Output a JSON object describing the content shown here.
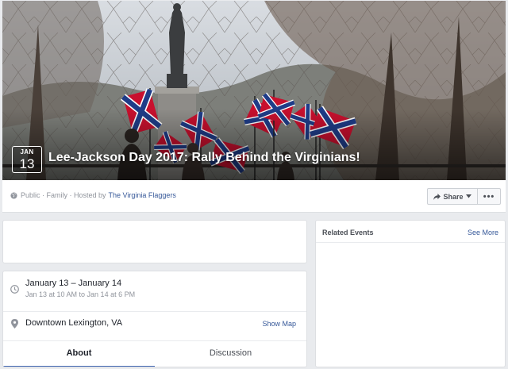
{
  "cover": {
    "image": "event-cover-photo",
    "badge_month": "JAN",
    "badge_day": "13",
    "title": "Lee-Jackson Day 2017: Rally Behind the Virginians!"
  },
  "info_bar": {
    "privacy_icon": "globe-icon",
    "meta_text": "Public · Family · Hosted by",
    "host": "The Virginia Flaggers",
    "share_label": "Share",
    "share_icon": "share-arrow-icon",
    "more_label": "•••"
  },
  "details": {
    "date_icon": "clock-icon",
    "date_main": "January 13 – January 14",
    "date_sub": "Jan 13 at 10 AM to Jan 14 at 6 PM",
    "location_icon": "location-pin-icon",
    "location": "Downtown Lexington, VA",
    "show_map": "Show Map"
  },
  "tabs": [
    {
      "label": "About",
      "active": true
    },
    {
      "label": "Discussion",
      "active": false
    }
  ],
  "related": {
    "title": "Related Events",
    "see_more": "See More"
  },
  "colors": {
    "page_bg": "#e9ebee",
    "link": "#365899",
    "tab_accent": "#4267b2",
    "flag_red": "#c8102e",
    "flag_blue": "#1f3c88"
  }
}
